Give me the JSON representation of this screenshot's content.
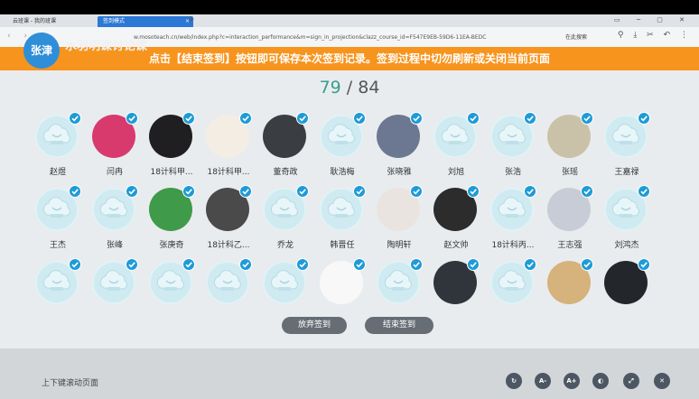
{
  "browser": {
    "tabs": [
      {
        "label": "云班课 - 我的班课"
      },
      {
        "label": "签到模式"
      }
    ],
    "url": "w.mosoteach.cn/web/index.php?c=interaction_performance&m=sign_in_projection&clazz_course_id=F547E9EB-59D6-11EA-BEDC",
    "zoom": "125%",
    "search_label": "在此搜索"
  },
  "header": {
    "teacher": "张津",
    "course": "水羽明课讨论课",
    "banner": "点击【结束签到】按钮即可保存本次签到记录。签到过程中切勿刷新或关闭当前页面"
  },
  "counter": {
    "signed": "79",
    "sep": " / ",
    "total": "84"
  },
  "students": [
    {
      "name": "赵煜",
      "avatar": "cloud-default-avatar"
    },
    {
      "name": "闫冉",
      "avatar": "photo-avatar",
      "color": "#d83a6e"
    },
    {
      "name": "18计科甲...",
      "avatar": "photo-avatar",
      "color": "#1f1f22"
    },
    {
      "name": "18计科甲...",
      "avatar": "photo-avatar",
      "color": "#f4ede4"
    },
    {
      "name": "董奇政",
      "avatar": "photo-avatar",
      "color": "#3a3d42"
    },
    {
      "name": "耿浩梅",
      "avatar": "cloud-default-avatar"
    },
    {
      "name": "张晓雅",
      "avatar": "photo-avatar",
      "color": "#6c7891"
    },
    {
      "name": "刘旭",
      "avatar": "cloud-default-avatar"
    },
    {
      "name": "张浩",
      "avatar": "cloud-default-avatar"
    },
    {
      "name": "张瑶",
      "avatar": "photo-avatar",
      "color": "#c9c2a8"
    },
    {
      "name": "王嘉禄",
      "avatar": "cloud-default-avatar"
    },
    {
      "name": "王杰",
      "avatar": "cloud-default-avatar"
    },
    {
      "name": "张峰",
      "avatar": "cloud-default-avatar"
    },
    {
      "name": "张庚奇",
      "avatar": "photo-avatar",
      "color": "#3f9a49"
    },
    {
      "name": "18计科乙...",
      "avatar": "photo-avatar",
      "color": "#4a4a4a"
    },
    {
      "name": "乔龙",
      "avatar": "cloud-default-avatar"
    },
    {
      "name": "韩晋任",
      "avatar": "cloud-default-avatar"
    },
    {
      "name": "陶明轩",
      "avatar": "photo-avatar",
      "color": "#e9e4e0"
    },
    {
      "name": "赵文帅",
      "avatar": "photo-avatar",
      "color": "#2c2c2c"
    },
    {
      "name": "18计科丙...",
      "avatar": "cloud-default-avatar"
    },
    {
      "name": "王志强",
      "avatar": "photo-avatar",
      "color": "#c7ccd6"
    },
    {
      "name": "刘鸿杰",
      "avatar": "cloud-default-avatar"
    },
    {
      "name": "",
      "avatar": "cloud-default-avatar"
    },
    {
      "name": "",
      "avatar": "cloud-default-avatar"
    },
    {
      "name": "",
      "avatar": "cloud-default-avatar"
    },
    {
      "name": "",
      "avatar": "cloud-default-avatar"
    },
    {
      "name": "",
      "avatar": "cloud-default-avatar"
    },
    {
      "name": "",
      "avatar": "photo-avatar",
      "color": "#f8f8f8"
    },
    {
      "name": "",
      "avatar": "cloud-default-avatar"
    },
    {
      "name": "",
      "avatar": "photo-avatar",
      "color": "#30353c"
    },
    {
      "name": "",
      "avatar": "cloud-default-avatar"
    },
    {
      "name": "",
      "avatar": "photo-avatar",
      "color": "#d6b27c"
    },
    {
      "name": "",
      "avatar": "photo-avatar",
      "color": "#23272c"
    }
  ],
  "buttons": {
    "give_up": "放弃签到",
    "end": "结束签到"
  },
  "footer": {
    "hint": "上下键滚动页面",
    "controls": [
      {
        "name": "refresh-icon",
        "label": "↻"
      },
      {
        "name": "font-decrease-icon",
        "label": "A-"
      },
      {
        "name": "font-increase-icon",
        "label": "A+"
      },
      {
        "name": "contrast-icon",
        "label": "◐"
      },
      {
        "name": "fullscreen-icon",
        "label": "⤢"
      },
      {
        "name": "close-icon",
        "label": "✕"
      }
    ]
  },
  "colors": {
    "banner": "#f7941d",
    "check": "#1e9bd7",
    "counter_signed": "#3a9e8c",
    "button": "#666d75"
  }
}
